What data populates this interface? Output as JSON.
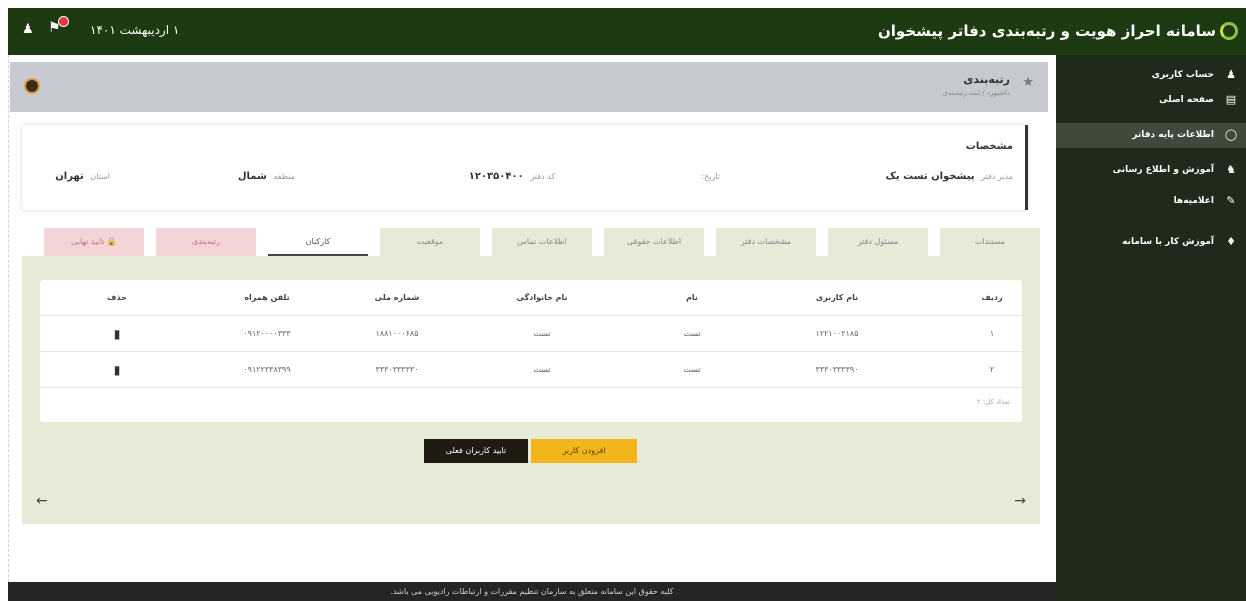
{
  "topbar": {
    "title": "سامانه احراز هویت و رتبه‌بندی دفاتر پیشخوان",
    "date": "۱ اردیبهشت ۱۴۰۱",
    "icons": {
      "logo": "app-logo-icon",
      "user": "user-icon",
      "notifications": "bell-icon"
    }
  },
  "sidebar": {
    "items": [
      {
        "label": "حساب کاربری",
        "icon": "user-icon"
      },
      {
        "label": "صفحه اصلی",
        "icon": "dashboard-icon"
      },
      {
        "label": "اطلاعات پایه دفاتر",
        "icon": "shield-icon",
        "active": true
      },
      {
        "label": "آموزش و اطلاع رسانی",
        "icon": "users-icon"
      },
      {
        "label": "اعلامیه‌ها",
        "icon": "pencil-icon"
      },
      {
        "label": "آموزش کار با سامانه",
        "icon": "graduation-icon"
      }
    ]
  },
  "header": {
    "title": "رتبه‌بندی",
    "breadcrumb": "داشبورد / ثبت رتبه‌بندی"
  },
  "info": {
    "heading": "مشخصات",
    "fields": [
      {
        "key": "مدیر دفتر",
        "value": "پیشخوان تست یک"
      },
      {
        "key": "تاریخ:",
        "value": ""
      },
      {
        "key": "کد دفتر",
        "value": "۱۲۰۳۵۰۴۰۰"
      },
      {
        "key": "منطقه",
        "value": "شمال"
      },
      {
        "key": "استان",
        "value": "تهران"
      }
    ]
  },
  "tabs": [
    "مستندات",
    "مسئول دفتر",
    "مشخصات دفتر",
    "اطلاعات حقوقی",
    "اطلاعات تماس",
    "موقعیت",
    "کارکنان",
    "رتبه‌بندی",
    "تایید نهایی"
  ],
  "active_tab": "کارکنان",
  "table": {
    "columns": [
      "ردیف",
      "نام کاربری",
      "نام",
      "نام خانوادگی",
      "شماره ملی",
      "تلفن همراه",
      "حذف"
    ],
    "rows": [
      [
        "۱",
        "۱۲۲۱۰۰۲۱۸۵",
        "تست",
        "تست",
        "۱۸۸۱۰۰۰۶۸۵",
        "۰۹۱۲۰۰۰۰۳۳۳",
        "trash-icon"
      ],
      [
        "۲",
        "۳۳۳۰۳۳۳۳۹۰",
        "تست",
        "تست",
        "۳۳۳۰۳۳۳۳۳۰",
        "۰۹۱۲۲۳۳۸۳۹۹",
        "trash-icon"
      ]
    ],
    "total": "تعداد کل: ۲"
  },
  "buttons": {
    "add": "افزودن کاربر",
    "confirm": "تایید کاربران فعلی"
  },
  "footer": "کلیه حقوق این سامانه متعلق به سازمان تنظیم مقررات و ارتباطات رادیویی می باشد."
}
